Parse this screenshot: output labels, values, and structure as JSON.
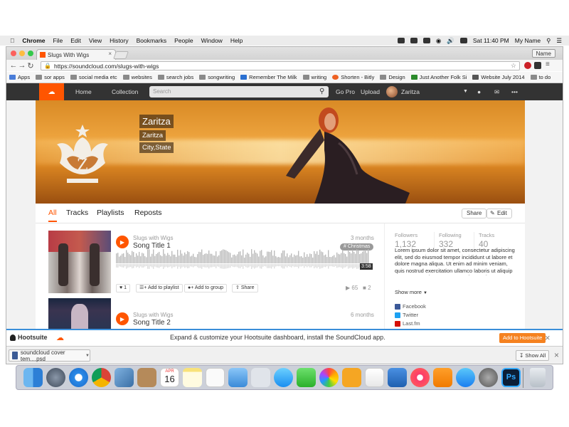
{
  "menubar": {
    "items": [
      "Chrome",
      "File",
      "Edit",
      "View",
      "History",
      "Bookmarks",
      "People",
      "Window",
      "Help"
    ],
    "clock": "Sat 11:40 PM",
    "user": "My Name"
  },
  "browser": {
    "tab_title": "Slugs With Wigs",
    "tab_close": "×",
    "profile_button": "Name",
    "url": "https://soundcloud.com/slugs-with-wigs",
    "bookmarks": [
      "Apps",
      "sor apps",
      "social media etc",
      "websites",
      "search jobs",
      "songwriting",
      "Remember The Milk",
      "writing",
      "Shorten - Bitly",
      "Design",
      "Just Another Folk Si",
      "Website July 2014",
      "to do"
    ]
  },
  "soundcloud": {
    "nav": {
      "home": "Home",
      "collection": "Collection",
      "search_placeholder": "Search",
      "gopro": "Go Pro",
      "upload": "Upload",
      "username": "Zaritza"
    },
    "profile": {
      "display_name": "Zaritza",
      "real_name": "Zaritza",
      "location": "City,State"
    },
    "tabs": [
      "All",
      "Tracks",
      "Playlists",
      "Reposts"
    ],
    "share_label": "Share",
    "edit_label": "Edit",
    "tracks": [
      {
        "uploader": "Slugs with Wigs",
        "title": "Song Title 1",
        "ago": "3 months",
        "tag": "# Christmas",
        "duration": "3:58",
        "likes": "1",
        "add_playlist": "Add to playlist",
        "add_group": "Add to group",
        "share": "Share",
        "plays": "65",
        "comments": "2"
      },
      {
        "uploader": "Slugs with Wigs",
        "title": "Song Title 2",
        "ago": "6 months"
      }
    ],
    "stats": {
      "followers_label": "Followers",
      "followers": "1,132",
      "following_label": "Following",
      "following": "332",
      "tracks_label": "Tracks",
      "tracks": "40"
    },
    "bio": "Lorem ipsum dolor sit amet, consectetur adipiscing elit, sed do eiusmod tempor incididunt ut labore et dolore magna aliqua. Ut enim ad minim veniam, quis nostrud exercitation ullamco laboris ut aliquip ex ea commodo consequat. Duis aute irure",
    "show_more": "Show more",
    "social": [
      "Facebook",
      "Twitter",
      "Last.fm"
    ]
  },
  "hootsuite": {
    "brand": "Hootsuite",
    "message": "Expand & customize your Hootsuite dashboard, install the SoundCloud app.",
    "button": "Add to Hootsuite",
    "close": "×"
  },
  "downloads": {
    "file": "soundcloud cover tem....psd",
    "show_all": "Show All",
    "close": "×"
  },
  "dock_calendar": {
    "month": "APR",
    "day": "16"
  },
  "colors": {
    "accent": "#ff5500",
    "nav": "#333333",
    "hootsuite_button": "#f58220"
  }
}
